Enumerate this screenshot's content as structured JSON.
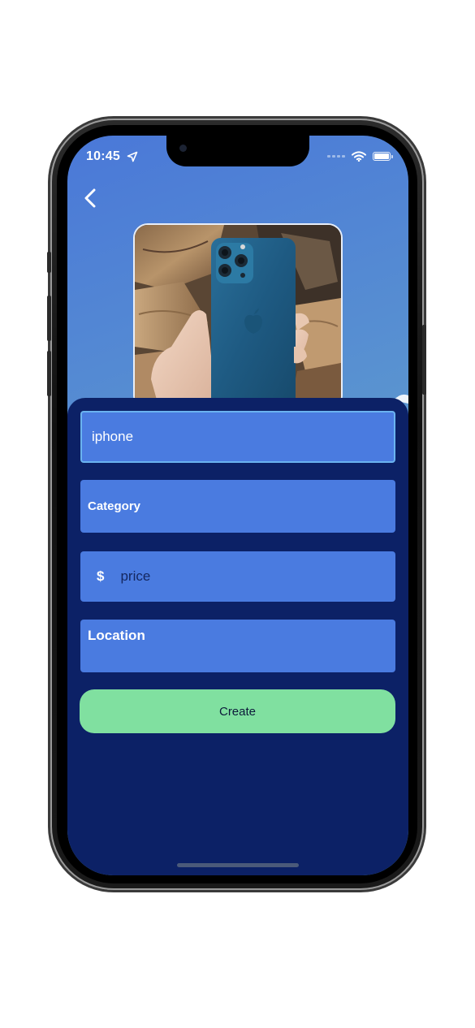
{
  "status_bar": {
    "time": "10:45",
    "location_icon": "location-arrow-icon",
    "wifi_icon": "wifi-icon",
    "battery_icon": "battery-icon"
  },
  "nav": {
    "back_icon": "chevron-left-icon"
  },
  "photo": {
    "subject": "product-photo"
  },
  "form": {
    "name_value": "iphone",
    "category_label": "Category",
    "price_symbol": "$",
    "price_placeholder": "price",
    "location_label": "Location",
    "create_label": "Create"
  },
  "colors": {
    "background_gradient_start": "#4a78d8",
    "background_gradient_end": "#64a8c6",
    "sheet": "#0c2166",
    "field": "#4a7be0",
    "field_focus_border": "#6ab3f0",
    "create_button": "#80e0a0"
  }
}
